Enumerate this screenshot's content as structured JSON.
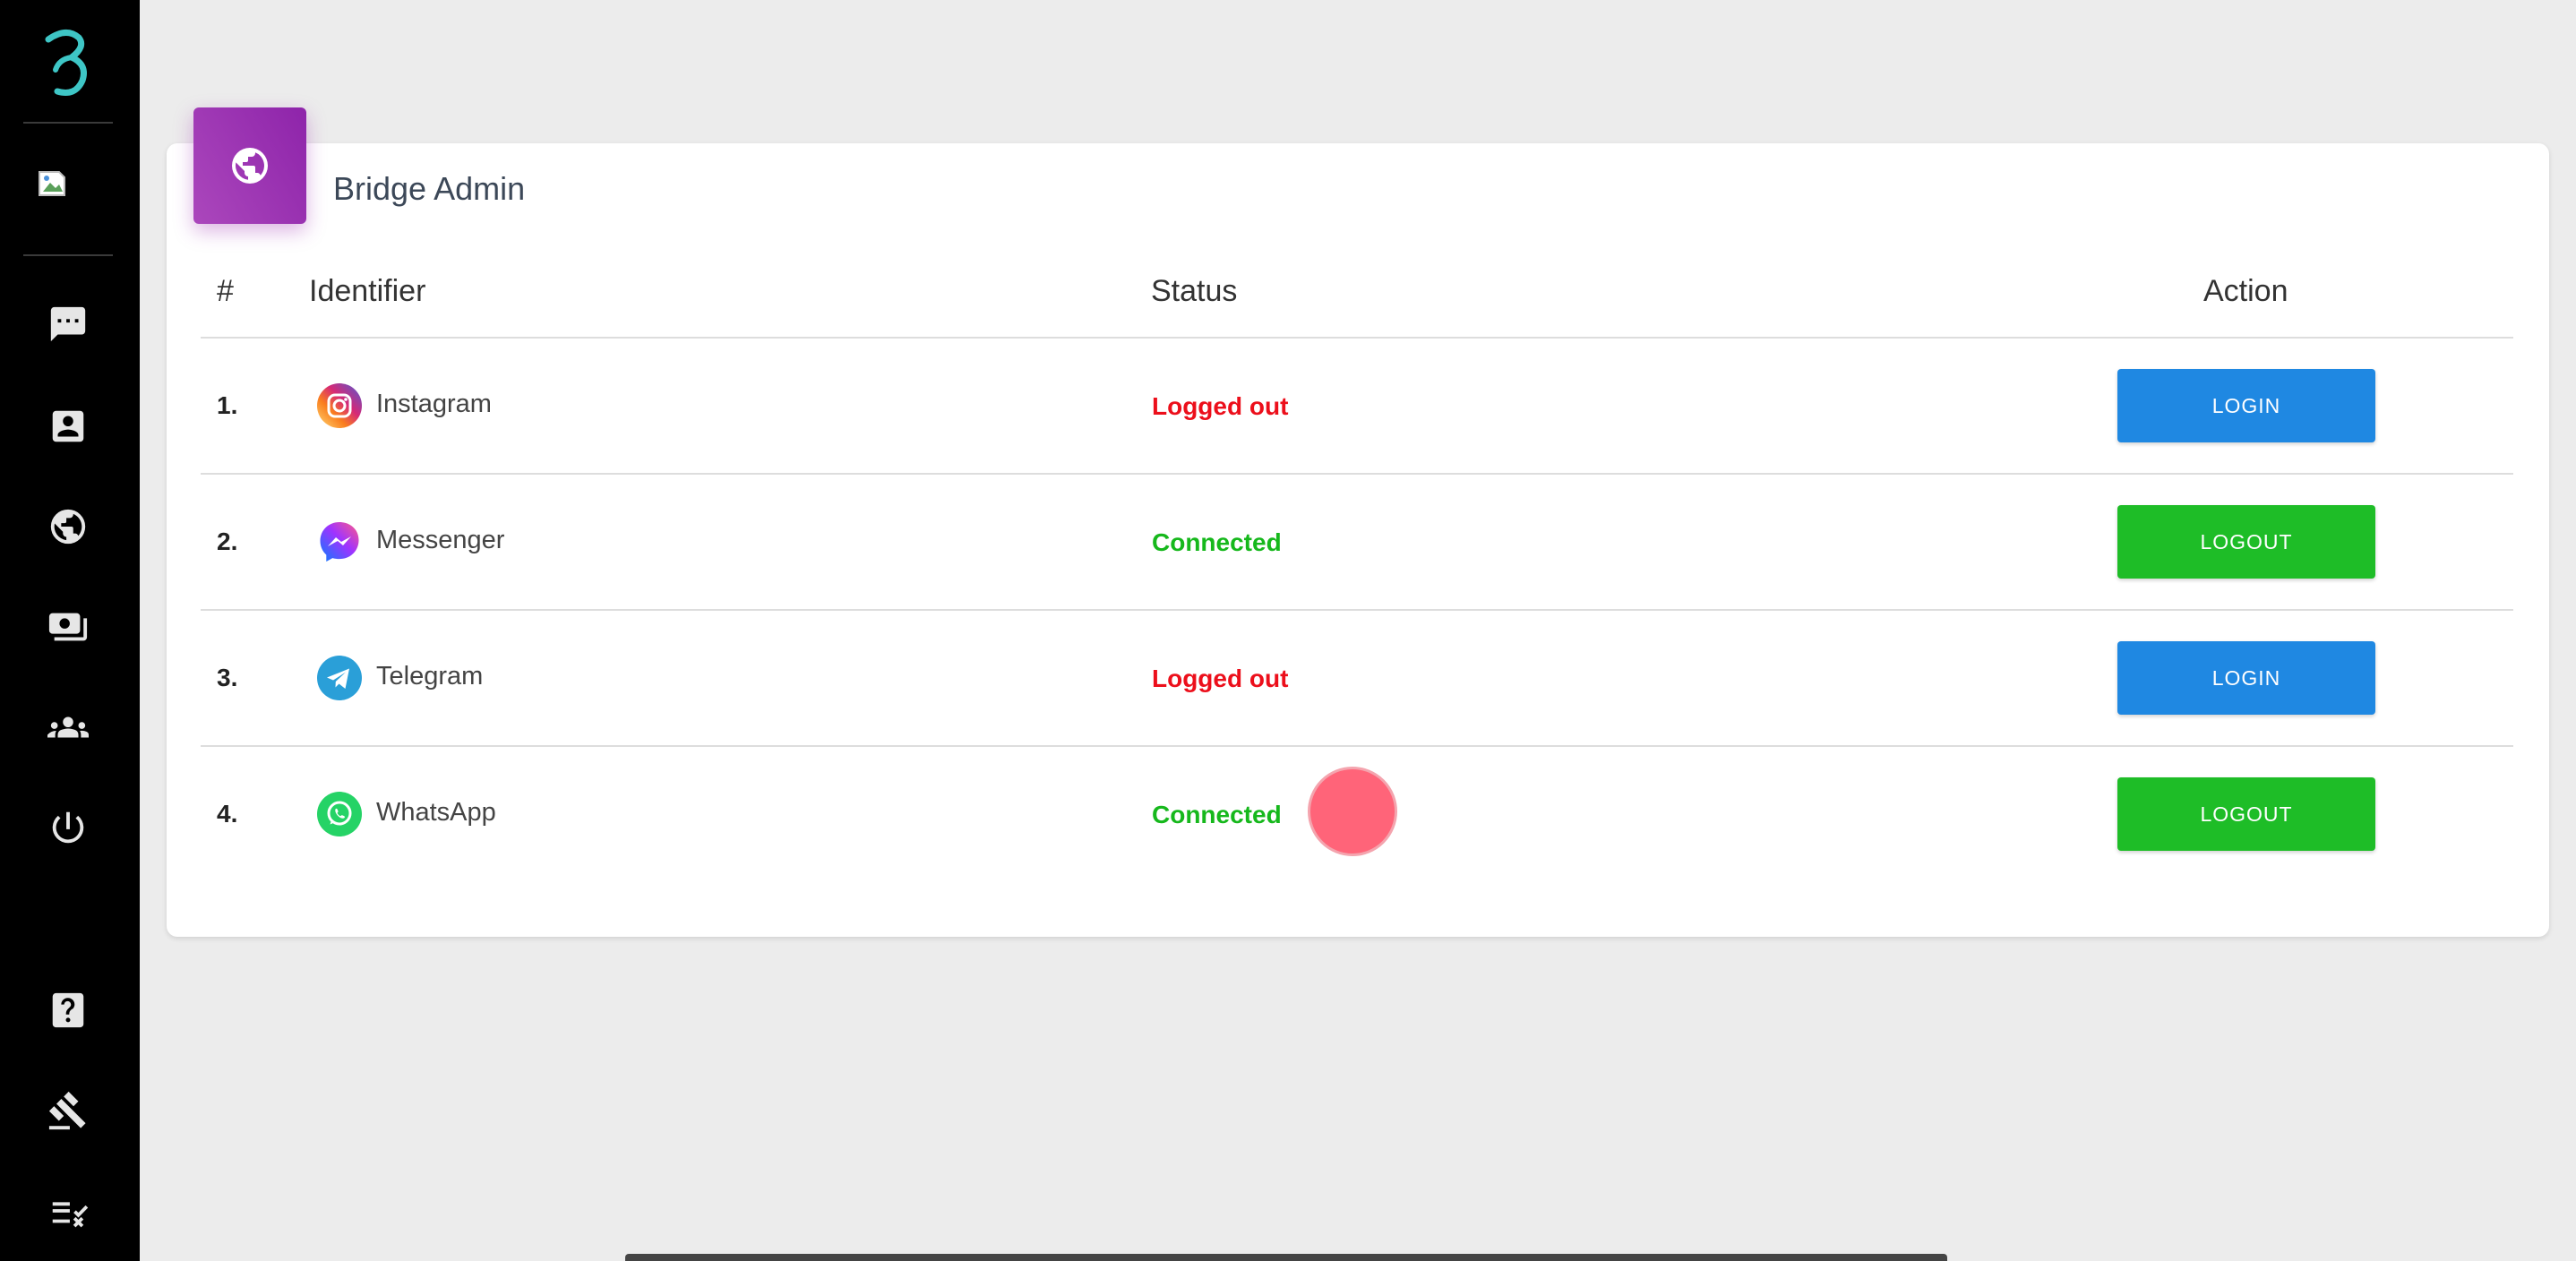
{
  "sidebar": {
    "logo": "bridge-logo-icon",
    "avatar": "broken-image-icon",
    "nav": [
      {
        "name": "chat-icon"
      },
      {
        "name": "contact-card-icon"
      },
      {
        "name": "globe-icon"
      },
      {
        "name": "payments-icon"
      },
      {
        "name": "groups-icon"
      },
      {
        "name": "power-icon"
      }
    ],
    "bottom": [
      {
        "name": "help-icon"
      },
      {
        "name": "gavel-icon"
      },
      {
        "name": "checklist-icon"
      }
    ]
  },
  "card": {
    "title": "Bridge Admin",
    "icon": "globe-icon",
    "accent": "#9c27b0"
  },
  "table": {
    "headers": {
      "num": "#",
      "identifier": "Identifier",
      "status": "Status",
      "action": "Action"
    },
    "rows": [
      {
        "num": "1.",
        "icon": "instagram-icon",
        "identifier": "Instagram",
        "status": "Logged out",
        "action": "LOGIN"
      },
      {
        "num": "2.",
        "icon": "messenger-icon",
        "identifier": "Messenger",
        "status": "Connected",
        "action": "LOGOUT"
      },
      {
        "num": "3.",
        "icon": "telegram-icon",
        "identifier": "Telegram",
        "status": "Logged out",
        "action": "LOGIN"
      },
      {
        "num": "4.",
        "icon": "whatsapp-icon",
        "identifier": "WhatsApp",
        "status": "Connected",
        "action": "LOGOUT"
      }
    ]
  },
  "colors": {
    "logged_out": "#ec0f1b",
    "connected": "#16b81c",
    "login_button": "#1f88e2",
    "logout_button": "#1ebd27",
    "logo": "#3ec6c6"
  }
}
